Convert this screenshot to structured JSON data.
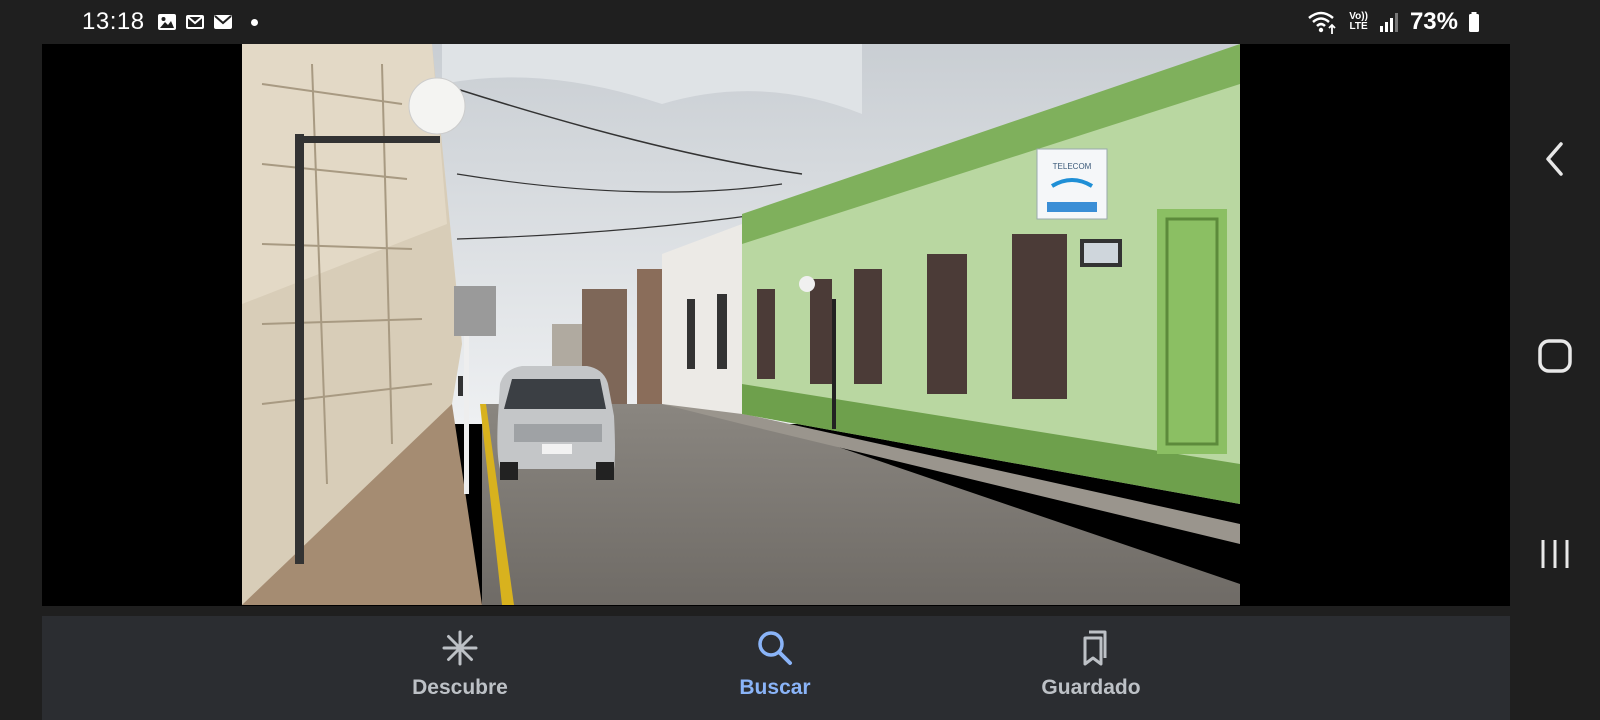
{
  "status_bar": {
    "time": "13:18",
    "left_icons": [
      "gallery-icon",
      "mail-outline-icon",
      "mail-icon",
      "dot-icon"
    ],
    "right_icons": [
      "wifi-icon",
      "volte-icon",
      "signal-icon",
      "battery-icon"
    ],
    "volte_top": "Vo))",
    "volte_bottom": "LTE",
    "battery": "73%"
  },
  "viewer": {
    "sign_text": "TELECOM",
    "image_subject": "street-photo"
  },
  "bottom_nav": {
    "items": [
      {
        "label": "Descubre",
        "icon": "asterisk-icon",
        "active": false
      },
      {
        "label": "Buscar",
        "icon": "search-icon",
        "active": true
      },
      {
        "label": "Guardado",
        "icon": "bookmarks-icon",
        "active": false
      }
    ],
    "active_color": "#8ab4f8",
    "inactive_color": "#bdc1c6"
  },
  "system_nav": {
    "buttons": [
      "back-icon",
      "home-icon",
      "recents-icon"
    ]
  }
}
